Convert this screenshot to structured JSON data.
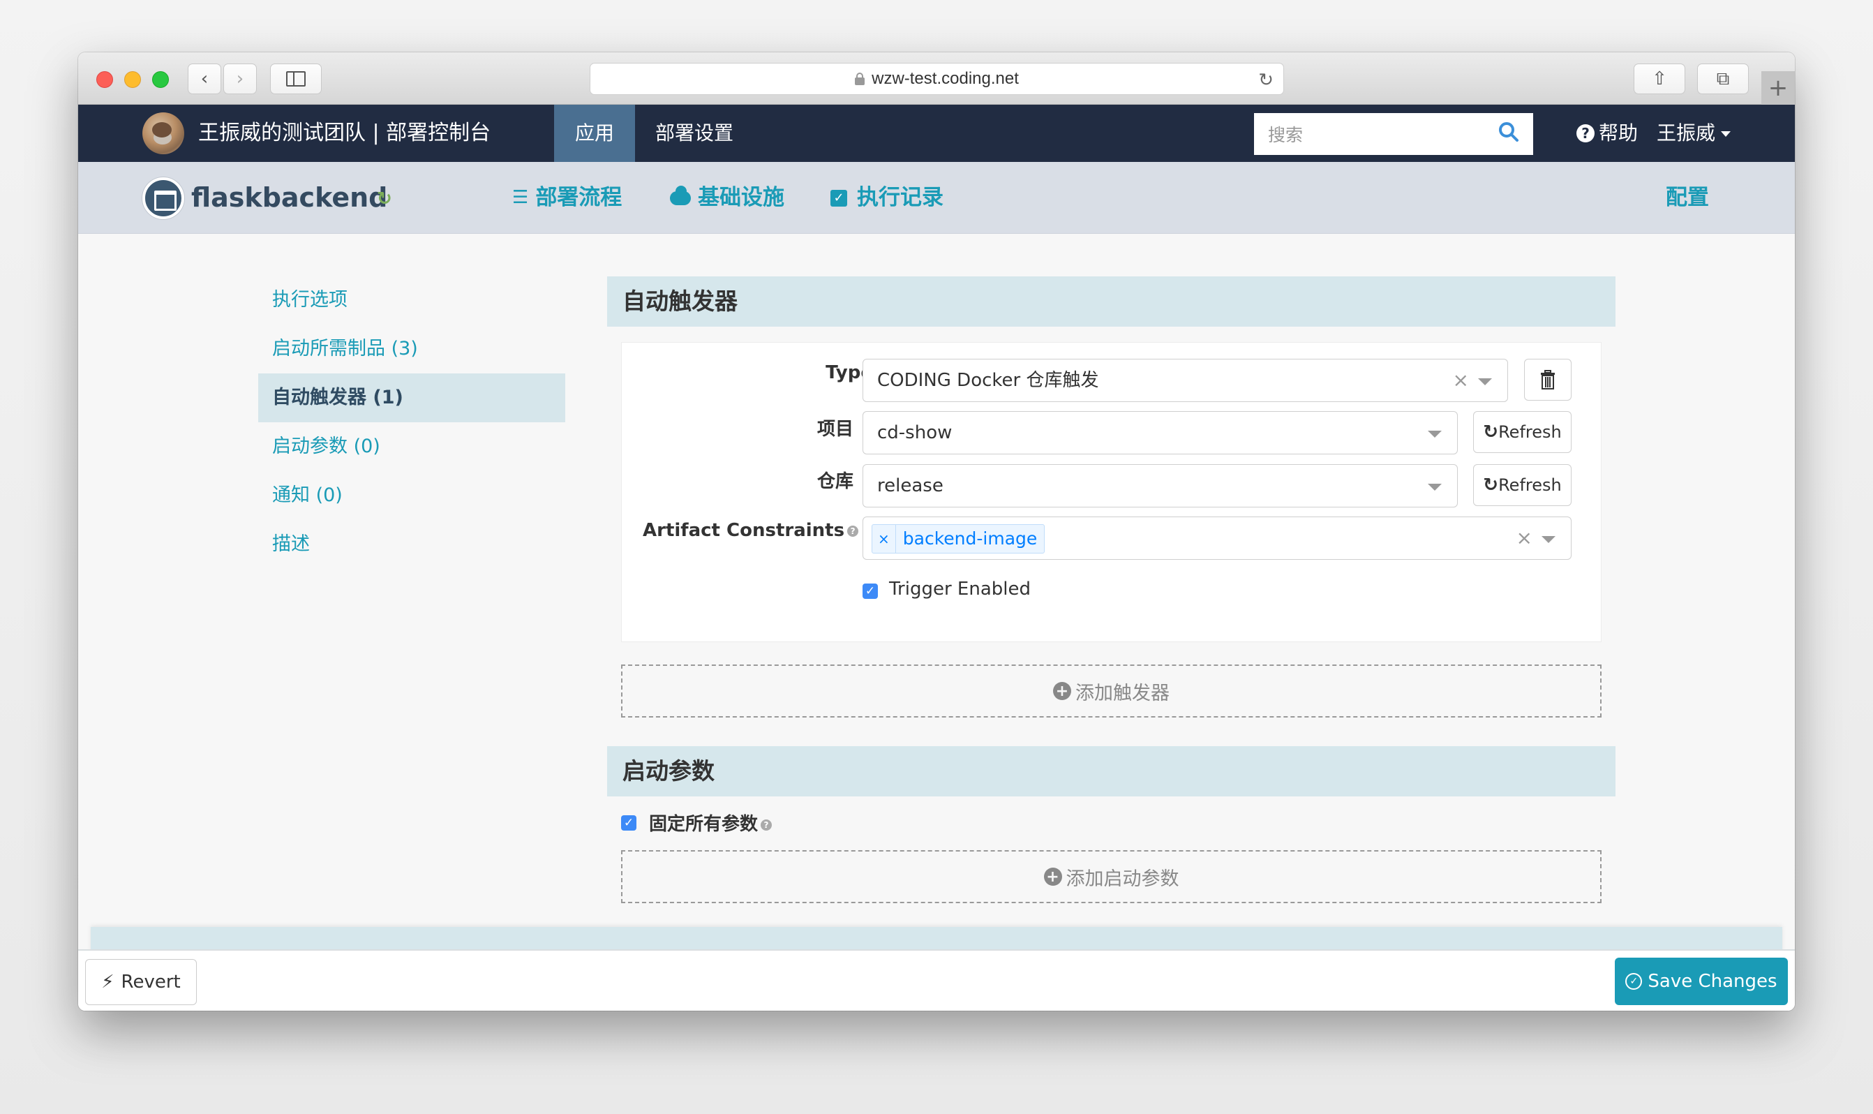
{
  "browser": {
    "url": "wzw-test.coding.net",
    "new_tab": "+"
  },
  "navbar": {
    "team_title": "王振威的测试团队 | 部署控制台",
    "tabs": [
      {
        "label": "应用",
        "active": true
      },
      {
        "label": "部署设置",
        "active": false
      }
    ],
    "search_placeholder": "搜索",
    "help_label": "帮助",
    "user_name": "王振威"
  },
  "subnav": {
    "app_name": "flaskbackend",
    "tabs": [
      {
        "label": "部署流程",
        "icon": "list-icon"
      },
      {
        "label": "基础设施",
        "icon": "cloud-icon"
      },
      {
        "label": "执行记录",
        "icon": "check-square-icon"
      }
    ],
    "config_label": "配置"
  },
  "sidebar": {
    "items": [
      {
        "label": "执行选项",
        "active": false
      },
      {
        "label": "启动所需制品 (3)",
        "active": false
      },
      {
        "label": "自动触发器 (1)",
        "active": true
      },
      {
        "label": "启动参数 (0)",
        "active": false
      },
      {
        "label": "通知 (0)",
        "active": false
      },
      {
        "label": "描述",
        "active": false
      }
    ]
  },
  "triggers": {
    "title": "自动触发器",
    "type_label": "Type",
    "type_value": "CODING Docker 仓库触发",
    "project_label": "项目",
    "project_value": "cd-show",
    "repo_label": "仓库",
    "repo_value": "release",
    "refresh_label": "Refresh",
    "constraints_label": "Artifact Constraints",
    "constraints_tags": [
      "backend-image"
    ],
    "trigger_enabled_label": "Trigger Enabled",
    "trigger_enabled": true,
    "add_label": "添加触发器"
  },
  "params": {
    "title": "启动参数",
    "pin_all_label": "固定所有参数",
    "pin_all": true,
    "add_label": "添加启动参数"
  },
  "footer": {
    "revert_label": "Revert",
    "save_label": "Save Changes"
  }
}
